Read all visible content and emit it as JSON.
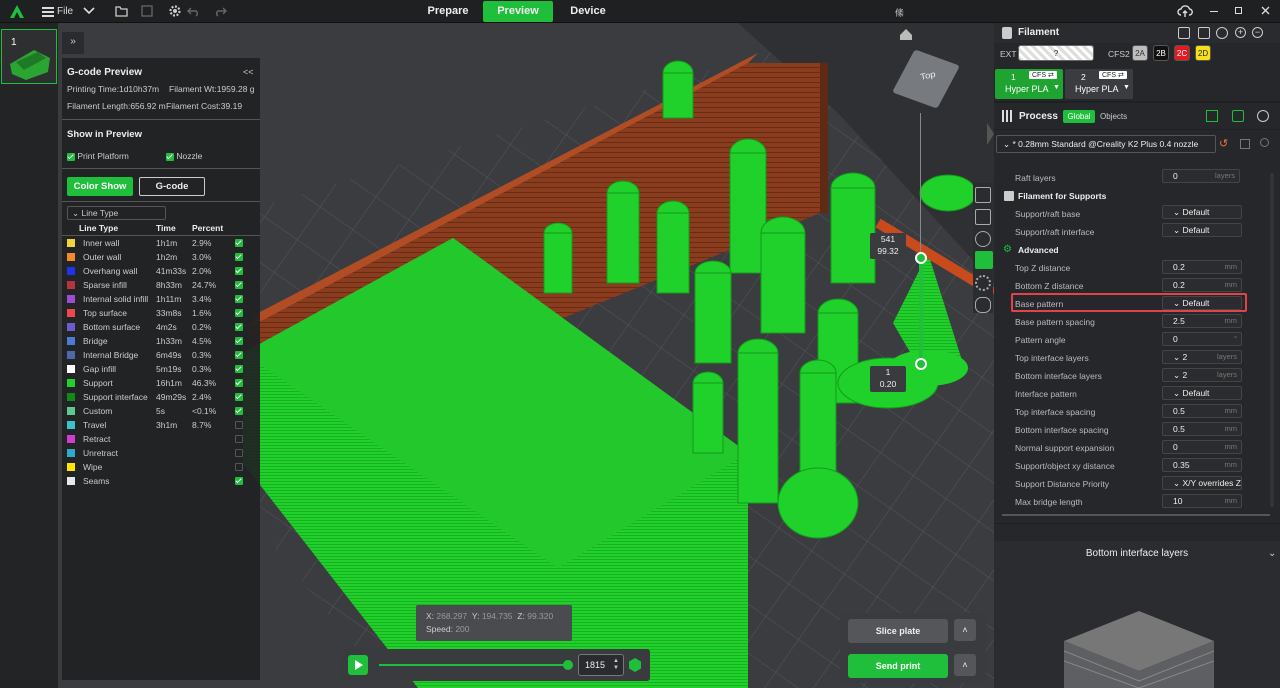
{
  "topbar": {
    "file_label": "File",
    "tabs": [
      "Prepare",
      "Preview",
      "Device"
    ],
    "center_icon_label": "絛"
  },
  "plate": {
    "number": "1"
  },
  "gcode": {
    "title": "G-code Preview",
    "printing_time": "Printing Time:1d10h37m",
    "filament_wt": "Filament Wt:1959.28 g",
    "filament_length": "Filament Length:656.92 m",
    "filament_cost": "Filament Cost:39.19",
    "show_in_preview": "Show in Preview",
    "print_platform": "Print Platform",
    "nozzle": "Nozzle",
    "color_show": "Color Show",
    "gcode_btn": "G-code",
    "line_type_select": "Line Type",
    "headers": [
      "Line Type",
      "Time",
      "Percent"
    ],
    "rows": [
      {
        "name": "Inner wall",
        "time": "1h1m",
        "pct": "2.9%",
        "color": "#f5d33b",
        "checked": true
      },
      {
        "name": "Outer wall",
        "time": "1h2m",
        "pct": "3.0%",
        "color": "#f58a2a",
        "checked": true
      },
      {
        "name": "Overhang wall",
        "time": "41m33s",
        "pct": "2.0%",
        "color": "#2132e8",
        "checked": true
      },
      {
        "name": "Sparse infill",
        "time": "8h33m",
        "pct": "24.7%",
        "color": "#b8343d",
        "checked": true
      },
      {
        "name": "Internal solid infill",
        "time": "1h11m",
        "pct": "3.4%",
        "color": "#9a4fcf",
        "checked": true
      },
      {
        "name": "Top surface",
        "time": "33m8s",
        "pct": "1.6%",
        "color": "#f0464f",
        "checked": true
      },
      {
        "name": "Bottom surface",
        "time": "4m2s",
        "pct": "0.2%",
        "color": "#6a5ccc",
        "checked": true
      },
      {
        "name": "Bridge",
        "time": "1h33m",
        "pct": "4.5%",
        "color": "#4c7bd1",
        "checked": true
      },
      {
        "name": "Internal Bridge",
        "time": "6m49s",
        "pct": "0.3%",
        "color": "#4d6aa8",
        "checked": true
      },
      {
        "name": "Gap infill",
        "time": "5m19s",
        "pct": "0.3%",
        "color": "#ffffff",
        "checked": true
      },
      {
        "name": "Support",
        "time": "16h1m",
        "pct": "46.3%",
        "color": "#1fd12a",
        "checked": true
      },
      {
        "name": "Support interface",
        "time": "49m29s",
        "pct": "2.4%",
        "color": "#128a18",
        "checked": true
      },
      {
        "name": "Custom",
        "time": "5s",
        "pct": "<0.1%",
        "color": "#5ec98f",
        "checked": true
      },
      {
        "name": "Travel",
        "time": "3h1m",
        "pct": "8.7%",
        "color": "#37c5c9",
        "checked": false
      },
      {
        "name": "Retract",
        "time": "",
        "pct": "",
        "color": "#d13bd1",
        "checked": false
      },
      {
        "name": "Unretract",
        "time": "",
        "pct": "",
        "color": "#2fa9c9",
        "checked": false
      },
      {
        "name": "Wipe",
        "time": "",
        "pct": "",
        "color": "#ffe600",
        "checked": false
      },
      {
        "name": "Seams",
        "time": "",
        "pct": "",
        "color": "#e8e8e8",
        "checked": true
      }
    ]
  },
  "slider": {
    "top_layer": "541",
    "top_height": "99.32",
    "bottom_layer": "1",
    "bottom_height": "0.20",
    "top_level_fraction": 1.0
  },
  "cube_label": "Top",
  "coords": {
    "x_label": "X:",
    "x": "268.297",
    "y_label": "Y:",
    "y": "194.735",
    "z_label": "Z:",
    "z": "99.320",
    "speed_label": "Speed:",
    "speed": "200"
  },
  "playback": {
    "value": "1815",
    "progress_fraction": 1.0
  },
  "actions": {
    "slice": "Slice plate",
    "send": "Send print"
  },
  "filament": {
    "title": "Filament",
    "ext": "EXT",
    "ext_slot": "?",
    "cfs2": "CFS2",
    "slots": [
      {
        "label": "2A",
        "color": "#bdbdbd",
        "text": "#333"
      },
      {
        "label": "2B",
        "color": "#111111",
        "text": "#fff"
      },
      {
        "label": "2C",
        "color": "#e01b24",
        "text": "#fff"
      },
      {
        "label": "2D",
        "color": "#f7e017",
        "text": "#222"
      }
    ],
    "cards": [
      {
        "num": "1",
        "badge": "CFS ⇄",
        "name": "Hyper PLA",
        "color": "#1fa431"
      },
      {
        "num": "2",
        "badge": "CFS ⇄",
        "name": "Hyper PLA",
        "color": "#3b3c3f"
      }
    ]
  },
  "process": {
    "title": "Process",
    "global": "Global",
    "objects": "Objects",
    "preset": "* 0.28mm Standard @Creality K2 Plus 0.4 nozzle",
    "raft_layers_label": "Raft layers",
    "raft_layers": "0",
    "raft_layers_unit": "layers",
    "filament_supports": "Filament for Supports",
    "support_base_label": "Support/raft base",
    "support_base": "Default",
    "support_interface_label": "Support/raft interface",
    "support_interface": "Default",
    "advanced": "Advanced",
    "params": [
      {
        "label": "Top Z distance",
        "value": "0.2",
        "unit": "mm",
        "type": "input"
      },
      {
        "label": "Bottom Z distance",
        "value": "0.2",
        "unit": "mm",
        "type": "input"
      },
      {
        "label": "Base pattern",
        "value": "Default",
        "unit": "",
        "type": "select",
        "highlight": true
      },
      {
        "label": "Base pattern spacing",
        "value": "2.5",
        "unit": "mm",
        "type": "input"
      },
      {
        "label": "Pattern angle",
        "value": "0",
        "unit": "°",
        "type": "input"
      },
      {
        "label": "Top interface layers",
        "value": "2",
        "unit": "layers",
        "type": "combo"
      },
      {
        "label": "Bottom interface layers",
        "value": "2",
        "unit": "layers",
        "type": "combo"
      },
      {
        "label": "Interface pattern",
        "value": "Default",
        "unit": "",
        "type": "select"
      },
      {
        "label": "Top interface spacing",
        "value": "0.5",
        "unit": "mm",
        "type": "input"
      },
      {
        "label": "Bottom interface spacing",
        "value": "0.5",
        "unit": "mm",
        "type": "input"
      },
      {
        "label": "Normal support expansion",
        "value": "0",
        "unit": "mm",
        "type": "input"
      },
      {
        "label": "Support/object xy distance",
        "value": "0.35",
        "unit": "mm",
        "type": "input"
      },
      {
        "label": "Support Distance Priority",
        "value": "X/Y overrides Z",
        "unit": "",
        "type": "select"
      },
      {
        "label": "Max bridge length",
        "value": "10",
        "unit": "mm",
        "type": "input"
      }
    ]
  },
  "help": {
    "title": "Bottom interface layers"
  },
  "colors": {
    "accent": "#1fbf3c",
    "highlight": "#e0434b"
  }
}
